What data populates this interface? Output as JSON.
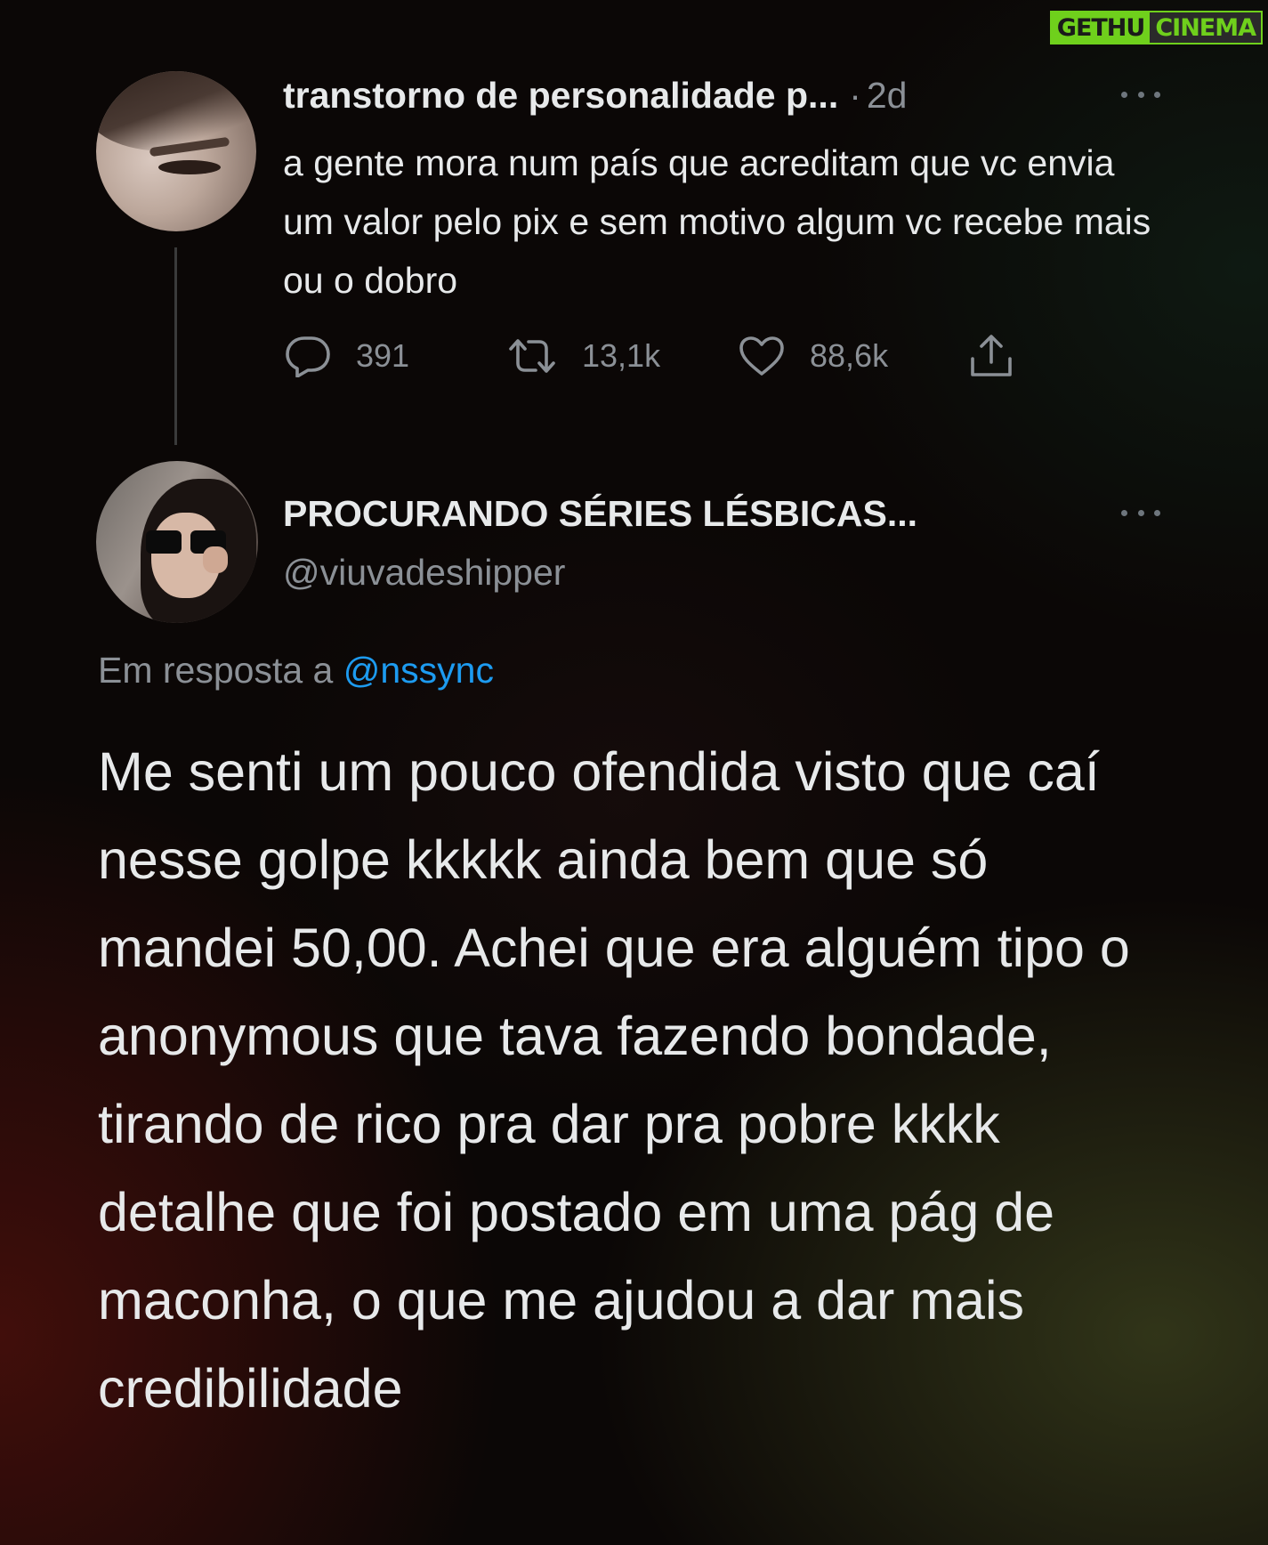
{
  "watermark": {
    "part1": "GETHU",
    "part2": "CINEMA"
  },
  "tweet1": {
    "name": "transtorno de personalidade p...",
    "separator": "·",
    "time": "2d",
    "text": "a gente mora num país que acreditam que vc envia um valor pelo pix e sem motivo algum vc recebe mais ou o dobro",
    "actions": {
      "replies": "391",
      "retweets": "13,1k",
      "likes": "88,6k"
    },
    "icons": [
      "reply-icon",
      "retweet-icon",
      "like-icon",
      "share-icon",
      "more-icon"
    ]
  },
  "tweet2": {
    "name": "PROCURANDO SÉRIES LÉSBICAS...",
    "handle": "@viuvadeshipper",
    "reply_prefix": "Em resposta a ",
    "reply_mention": "@nssync",
    "text": "Me senti um pouco ofendida visto que caí nesse golpe kkkkk ainda bem que só mandei 50,00. Achei que era alguém tipo o anonymous que tava fazendo bondade, tirando de rico pra dar pra pobre kkkk detalhe que foi postado em uma pág de maconha, o que me ajudou a dar mais credibilidade"
  },
  "colors": {
    "text": "#e7e9ea",
    "secondary": "#8b9096",
    "link": "#1d9bf0",
    "watermark_green": "#6fd01c"
  }
}
